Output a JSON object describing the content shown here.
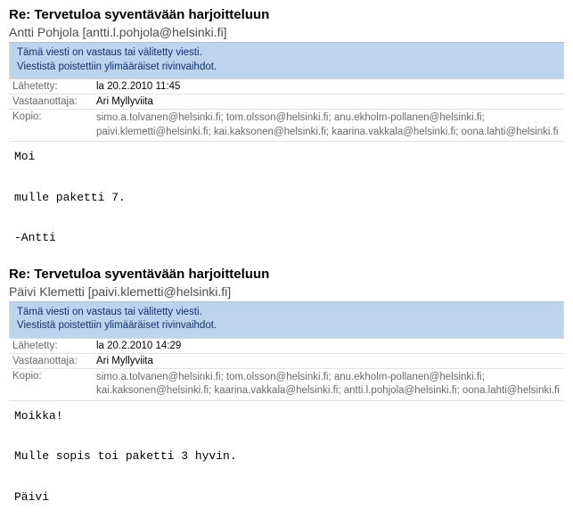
{
  "messages": [
    {
      "subject": "Re: Tervetuloa syventävään harjoitteluun",
      "sender_display": "Antti Pohjola [antti.l.pohjola@helsinki.fi]",
      "notice1": "Tämä viesti on vastaus tai välitetty viesti.",
      "notice2": "Viestistä poistettiin ylimääräiset rivinvaihdot.",
      "sent_label": "Lähetetty:",
      "sent_value": "la 20.2.2010 11:45",
      "to_label": "Vastaanottaja:",
      "to_value": "Ari Myllyviita",
      "cc_label": "Kopio:",
      "cc_value": "simo.a.tolvanen@helsinki.fi; tom.olsson@helsinki.fi; anu.ekholm-pollanen@helsinki.fi; paivi.klemetti@helsinki.fi; kai.kaksonen@helsinki.fi; kaarina.vakkala@helsinki.fi; oona.lahti@helsinki.fi",
      "body": "Moi\n\nmulle paketti 7.\n\n-Antti"
    },
    {
      "subject": "Re: Tervetuloa syventävään harjoitteluun",
      "sender_display": "Päivi Klemetti [paivi.klemetti@helsinki.fi]",
      "notice1": "Tämä viesti on vastaus tai välitetty viesti.",
      "notice2": "Viestistä poistettiin ylimääräiset rivinvaihdot.",
      "sent_label": "Lähetetty:",
      "sent_value": "la 20.2.2010 14:29",
      "to_label": "Vastaanottaja:",
      "to_value": "Ari Myllyviita",
      "cc_label": "Kopio:",
      "cc_value": "simo.a.tolvanen@helsinki.fi; tom.olsson@helsinki.fi; anu.ekholm-pollanen@helsinki.fi; kai.kaksonen@helsinki.fi; kaarina.vakkala@helsinki.fi; antti.l.pohjola@helsinki.fi; oona.lahti@helsinki.fi",
      "body": "Moikka!\n\nMulle sopis toi paketti 3 hyvin.\n\nPäivi"
    }
  ]
}
